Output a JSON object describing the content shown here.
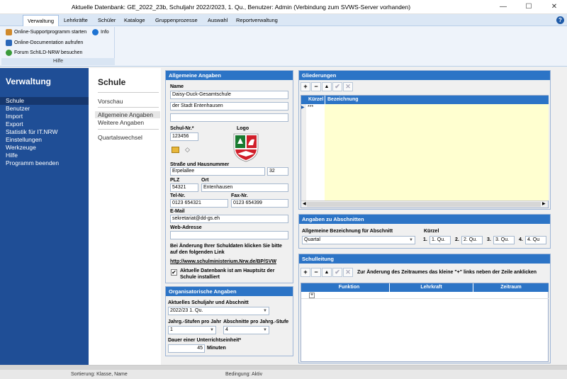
{
  "window": {
    "title": "Aktuelle Datenbank: GE_2022_23b, Schuljahr 2022/2023, 1. Qu., Benutzer: Admin (Verbindung zum SVWS-Server vorhanden)",
    "min": "—",
    "max": "☐",
    "close": "✕"
  },
  "menu": [
    "Verwaltung",
    "Lehrkräfte",
    "Schüler",
    "Kataloge",
    "Gruppenprozesse",
    "Auswahl",
    "Reportverwaltung"
  ],
  "help_icon": "?",
  "ribbon": {
    "support": "Online-Supportprogramm starten",
    "info": "Info",
    "docs": "Online-Documentation aufrufen",
    "forum": "Forum SchILD-NRW besuchen",
    "group_label": "Hilfe"
  },
  "leftnav": {
    "title": "Verwaltung",
    "items": [
      "Schule",
      "Benutzer",
      "Import",
      "Export",
      "Statistik für IT.NRW",
      "Einstellungen",
      "Werkzeuge",
      "Hilfe",
      "Programm beenden"
    ]
  },
  "subnav": {
    "title": "Schule",
    "items": [
      "Vorschau",
      "Allgemeine Angaben",
      "Weitere Angaben",
      "Quartalswechsel"
    ]
  },
  "allgemein": {
    "title": "Allgemeine Angaben",
    "name_label": "Name",
    "name1": "Daisy-Duck-Gesamtschule",
    "name2": "der Stadt Entenhausen",
    "name3": "",
    "schulnr_label": "Schul-Nr.*",
    "schulnr": "123456",
    "logo_label": "Logo",
    "strasse_label": "Straße und Hausnummer",
    "strasse": "Erpelallee",
    "hausnr": "32",
    "plz_label": "PLZ",
    "plz": "54321",
    "ort_label": "Ort",
    "ort": "Entenhausen",
    "tel_label": "Tel-Nr.",
    "tel": "0123 654321",
    "fax_label": "Fax-Nr.",
    "fax": "0123 654399",
    "email_label": "E-Mail",
    "email": "sekretariat@dd-gs.eh",
    "web_label": "Web-Adresse",
    "web": "",
    "hint1": "Bei Änderung Ihrer Schuldaten klicken Sie bitte",
    "hint2": "auf den folgenden Link",
    "link": "http://www.schulministerium.Nrw.de/BP/SVW",
    "check_text1": "Aktuelle Datenbank ist am Hauptsitz der",
    "check_text2": "Schule installiert",
    "check_mark": "✔"
  },
  "org": {
    "title": "Organisatorische Angaben",
    "sj_label": "Aktuelles Schuljahr und Abschnitt",
    "sj_value": "2022/23 1. Qu.",
    "jahrg_label": "Jahrg.-Stufen pro Jahr",
    "jahrg_value": "1",
    "abschn_label": "Abschnitte pro Jahrg.-Stufe",
    "abschn_value": "4",
    "dauer_label": "Dauer einer Unterrichtseinheit*",
    "dauer_value": "45",
    "dauer_unit": "Minuten"
  },
  "gliederungen": {
    "title": "Gliederungen",
    "col_kuerzel": "Kürzel",
    "col_bez": "Bezeichnung",
    "new_row": "***"
  },
  "abschnitte": {
    "title": "Angaben zu Abschnitten",
    "bez_label": "Allgemeine Bezeichnung für Abschnitt",
    "bez_value": "Quartal",
    "kuerzel_label": "Kürzel",
    "k1_label": "1.",
    "k1": "1. Qu.",
    "k2_label": "2.",
    "k2": "2. Qu.",
    "k3_label": "3.",
    "k3": "3. Qu.",
    "k4_label": "4.",
    "k4": "4. Qu"
  },
  "schulleitung": {
    "title": "Schulleitung",
    "hint": "Zur Änderung des Zeitraumes das kleine \"+\" links neben der Zeile anklicken",
    "col_funktion": "Funktion",
    "col_lehrkraft": "Lehrkraft",
    "col_zeitraum": "Zeitraum",
    "expand": "+"
  },
  "toolbar_icons": {
    "add": "+",
    "remove": "−",
    "up": "▲",
    "ok": "✔",
    "cancel": "✕"
  },
  "status": {
    "sort": "Sortierung: Klasse, Name",
    "cond": "Bedingung: Aktiv"
  },
  "colors": {
    "nav_bg": "#1f4e96",
    "panel_head": "#2c74c6",
    "grid_row": "#ffffd0"
  }
}
